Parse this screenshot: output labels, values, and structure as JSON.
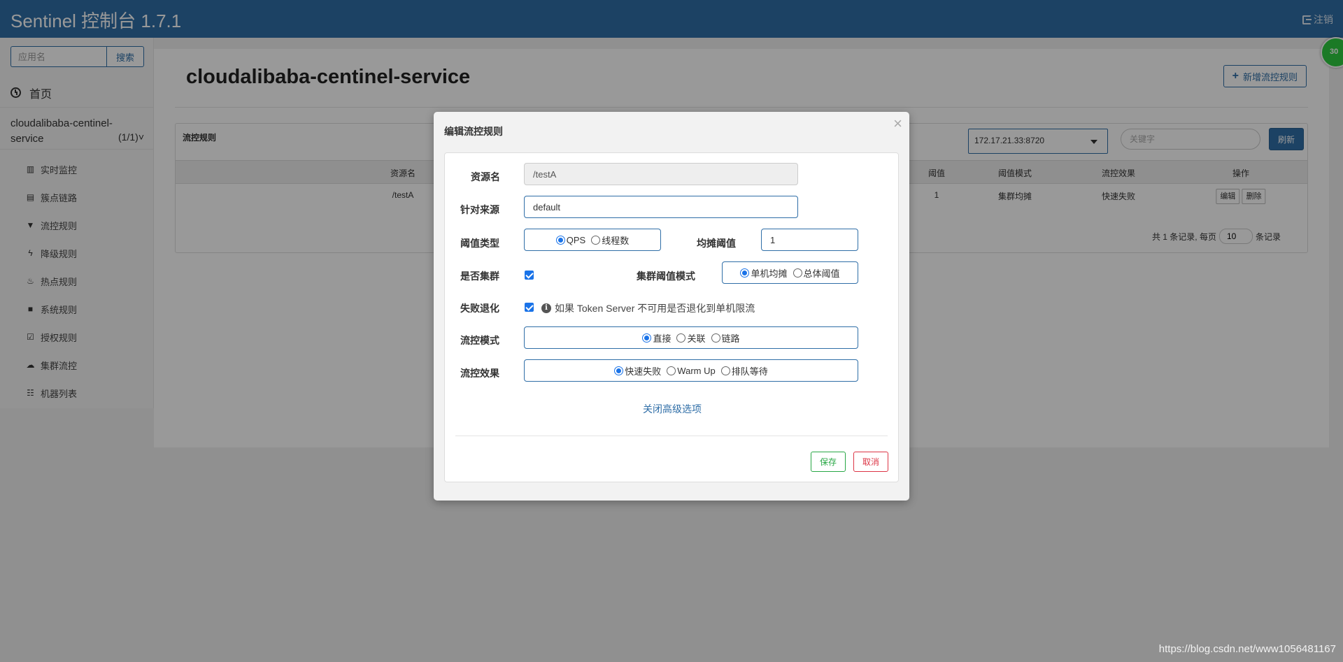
{
  "header": {
    "brand": "Sentinel 控制台 1.7.1",
    "logout_label": "注销",
    "badge": "30"
  },
  "sidebar": {
    "search_placeholder": "应用名",
    "search_button": "搜索",
    "home_label": "首页",
    "app": {
      "name_line1": "cloudalibaba-centinel-",
      "name_line2": "service",
      "count": "(1/1)"
    },
    "menu": [
      {
        "label": "实时监控",
        "icon": "bar-chart-icon"
      },
      {
        "label": "簇点链路",
        "icon": "list-icon"
      },
      {
        "label": "流控规则",
        "icon": "filter-icon"
      },
      {
        "label": "降级规则",
        "icon": "flash-icon"
      },
      {
        "label": "热点规则",
        "icon": "fire-icon"
      },
      {
        "label": "系统规则",
        "icon": "lock-icon"
      },
      {
        "label": "授权规则",
        "icon": "check-square-icon"
      },
      {
        "label": "集群流控",
        "icon": "cloud-icon"
      },
      {
        "label": "机器列表",
        "icon": "th-list-icon"
      }
    ]
  },
  "main": {
    "title": "cloudalibaba-centinel-service",
    "add_button": "新增流控规则",
    "card_title": "流控规则",
    "machine_select": "172.17.21.33:8720",
    "keyword_placeholder": "关键字",
    "refresh_button": "刷新",
    "columns": [
      "资源名",
      "阈值",
      "阈值模式",
      "流控效果",
      "操作"
    ],
    "row": {
      "resource": "/testA",
      "threshold": "1",
      "threshold_mode": "集群均摊",
      "effect": "快速失败",
      "edit": "编辑",
      "delete": "删除"
    },
    "pager": {
      "prefix": "共 1 条记录, 每页",
      "page_size": "10",
      "suffix": "条记录"
    }
  },
  "modal": {
    "title": "编辑流控规则",
    "close": "×",
    "resource_label": "资源名",
    "resource_value": "/testA",
    "source_label": "针对来源",
    "source_value": "default",
    "threshold_type_label": "阈值类型",
    "threshold_type_options": [
      "QPS",
      "线程数"
    ],
    "avg_threshold_label": "均摊阈值",
    "avg_threshold_value": "1",
    "cluster_label": "是否集群",
    "cluster_mode_label": "集群阈值模式",
    "cluster_mode_options": [
      "单机均摊",
      "总体阈值"
    ],
    "fallback_label": "失败退化",
    "fallback_info_icon": "i",
    "fallback_hint": "如果 Token Server 不可用是否退化到单机限流",
    "strategy_label": "流控模式",
    "strategy_options": [
      "直接",
      "关联",
      "链路"
    ],
    "effect_label": "流控效果",
    "effect_options": [
      "快速失败",
      "Warm Up",
      "排队等待"
    ],
    "advanced_link": "关闭高级选项",
    "save_button": "保存",
    "cancel_button": "取消"
  },
  "watermark": "https://blog.csdn.net/www1056481167"
}
